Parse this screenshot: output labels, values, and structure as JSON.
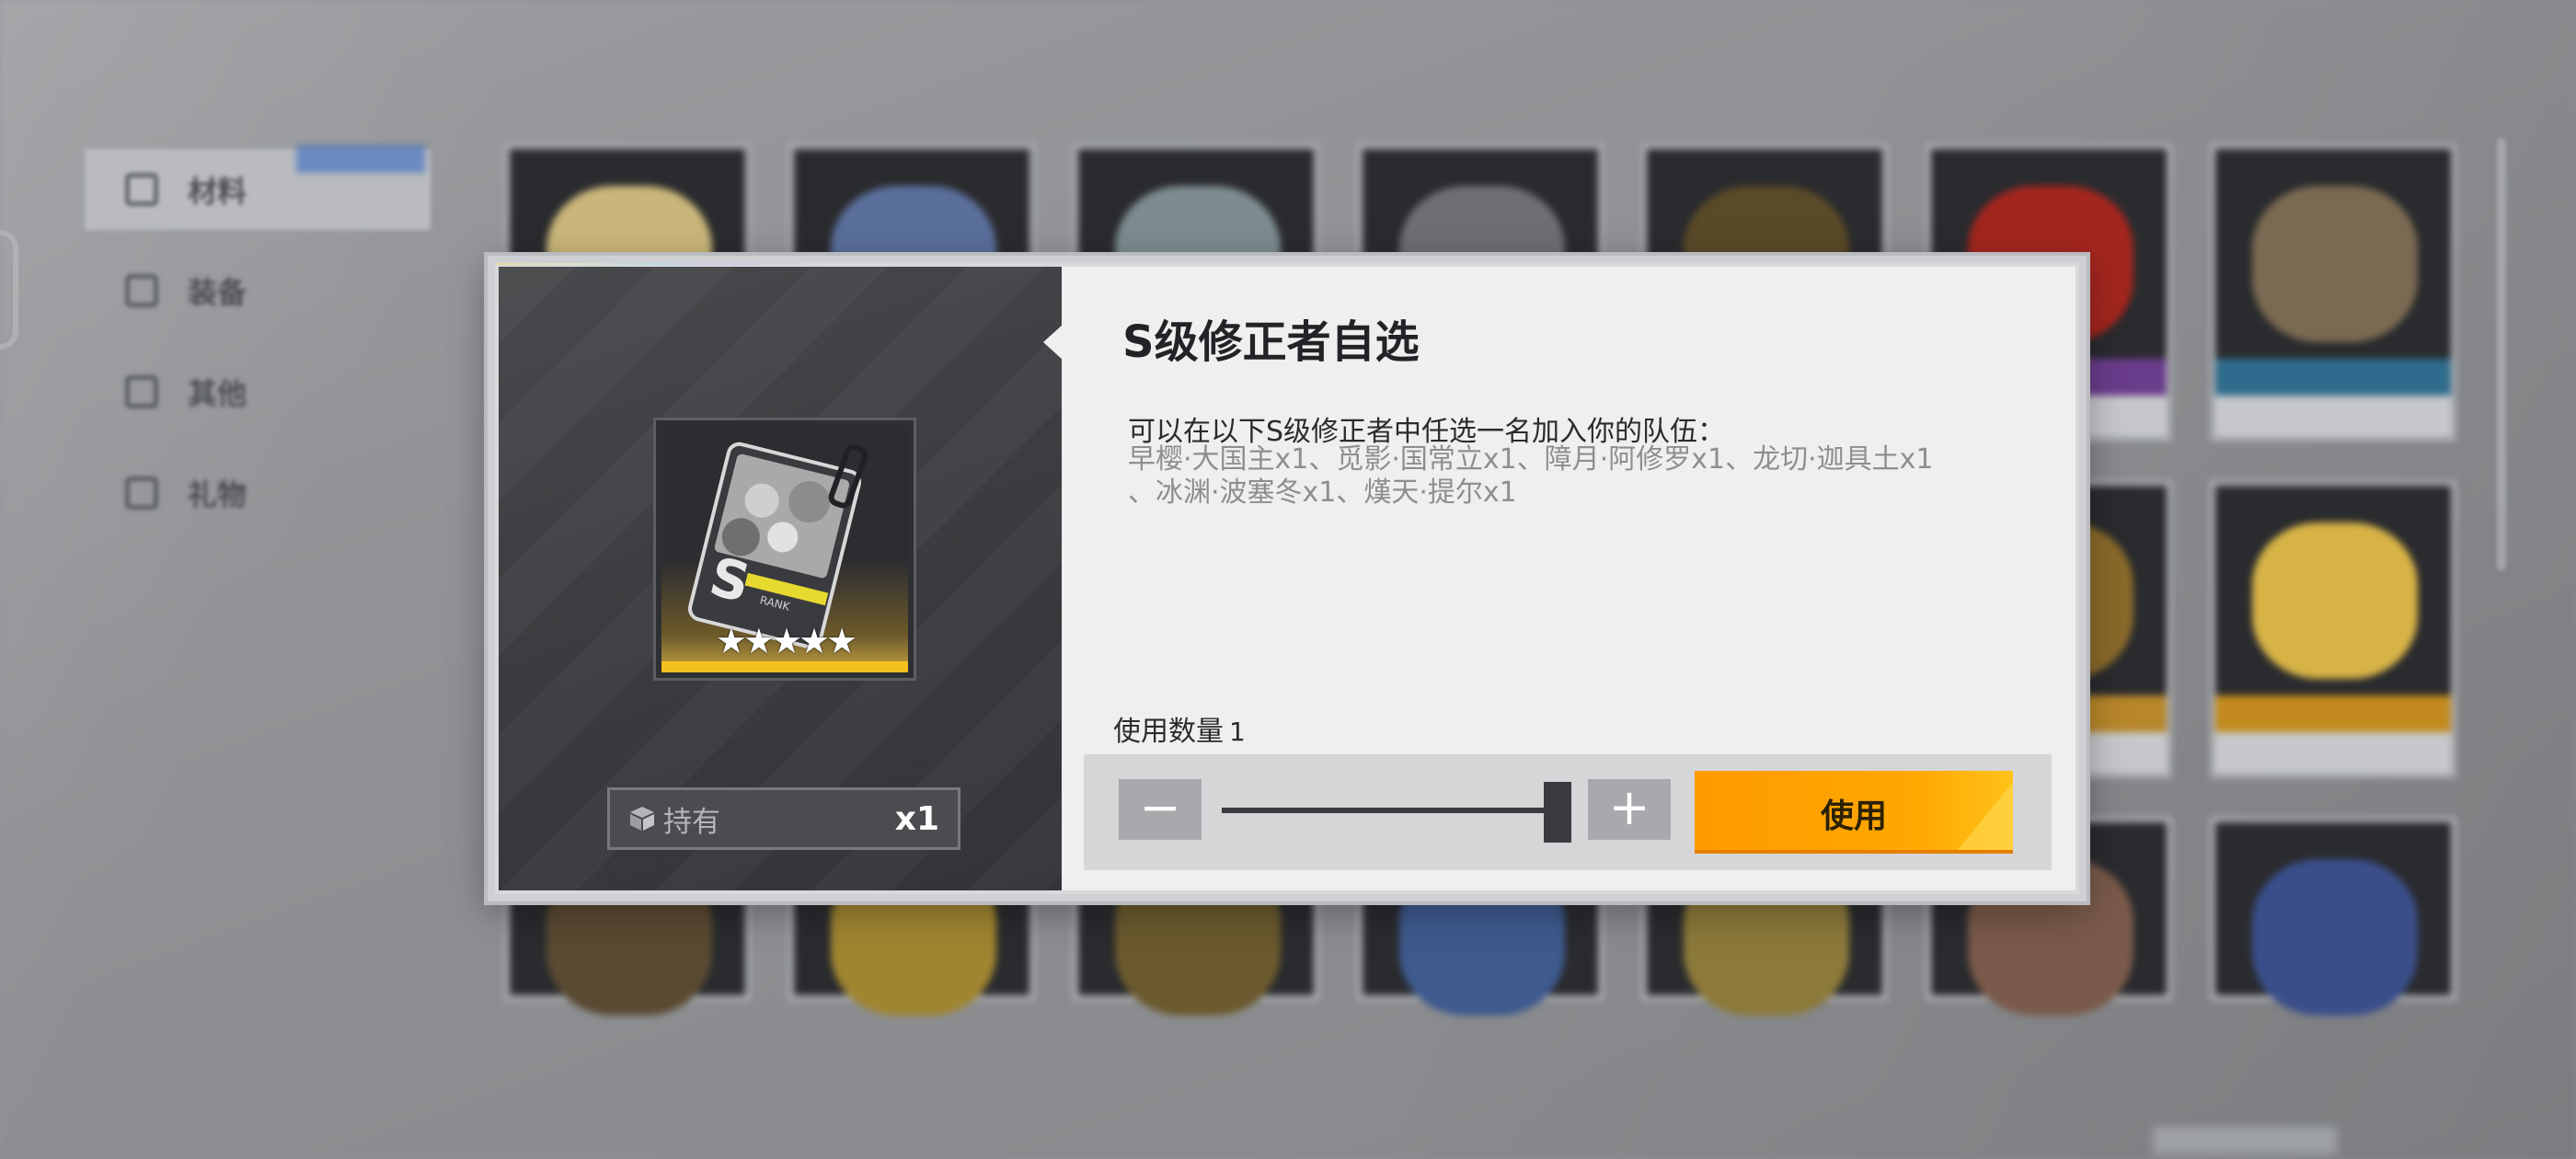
{
  "background": {
    "side_nav": [
      {
        "label": "材料",
        "active": true
      },
      {
        "label": "装备",
        "active": false
      },
      {
        "label": "其他",
        "active": false
      },
      {
        "label": "礼物",
        "active": false
      }
    ]
  },
  "modal": {
    "title": "S级修正者自选",
    "description": "可以在以下S级修正者中任选一名加入你的队伍：",
    "options_line1": "早樱·大国主x1、觅影·国常立x1、障月·阿修罗x1、龙切·迦具土x1",
    "options_line2": "、冰渊·波塞冬x1、熯天·提尔x1",
    "item_icon": "s-rank-card-icon",
    "item_stars": "★★★★★",
    "card_letter": "S",
    "card_rank": "RANK",
    "owned_label": "持有",
    "owned_count": "x1",
    "quantity_label": "使用数量",
    "quantity_value": "1",
    "minus_symbol": "−",
    "plus_symbol": "+",
    "use_button_label": "使用",
    "slider_level": 1.0,
    "colors": {
      "accent": "#ffa800",
      "left_panel": "#404144",
      "right_panel": "#efefef"
    }
  }
}
